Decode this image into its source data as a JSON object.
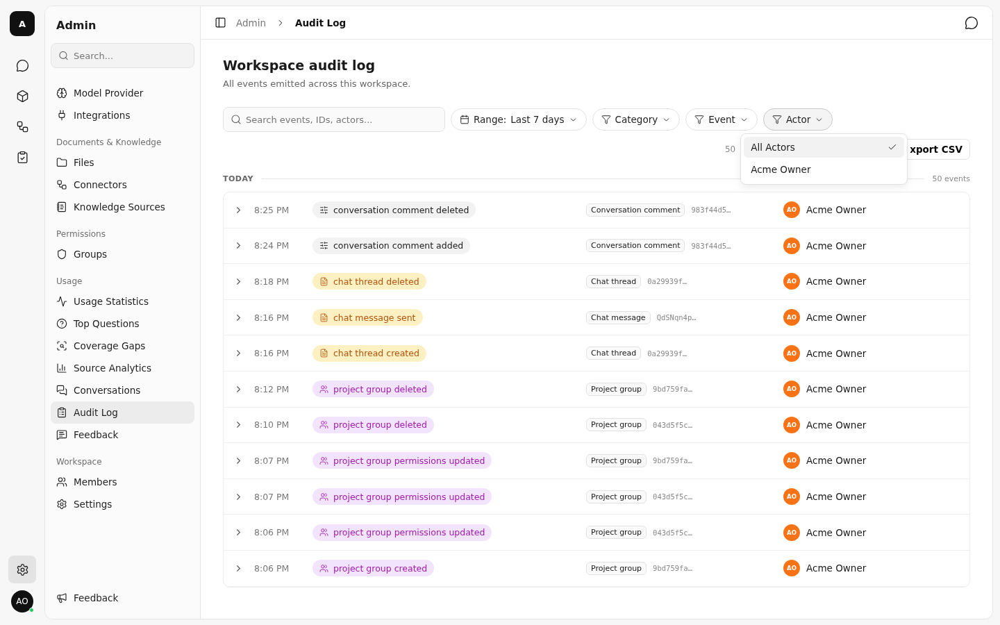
{
  "rail": {
    "logo": "A",
    "items": [
      {
        "selected": false
      },
      {
        "selected": false
      },
      {
        "selected": false
      },
      {
        "selected": false
      },
      {
        "selected": true
      }
    ],
    "avatar": {
      "initials": "AO",
      "online": true
    }
  },
  "sidebar": {
    "title": "Admin",
    "search": {
      "placeholder": "Search..."
    },
    "footer": "Feedback",
    "sections": [
      {
        "items": [
          {
            "label": "Model Provider",
            "selected": false
          },
          {
            "label": "Integrations",
            "selected": false
          }
        ]
      },
      {
        "label": "Documents & Knowledge",
        "items": [
          {
            "label": "Files",
            "selected": false
          },
          {
            "label": "Connectors",
            "selected": false
          },
          {
            "label": "Knowledge Sources",
            "selected": false
          }
        ]
      },
      {
        "label": "Permissions",
        "items": [
          {
            "label": "Groups",
            "selected": false
          }
        ]
      },
      {
        "label": "Usage",
        "items": [
          {
            "label": "Usage Statistics",
            "selected": false
          },
          {
            "label": "Top Questions",
            "selected": false
          },
          {
            "label": "Coverage Gaps",
            "selected": false
          },
          {
            "label": "Source Analytics",
            "selected": false
          },
          {
            "label": "Conversations",
            "selected": false
          },
          {
            "label": "Audit Log",
            "selected": true
          },
          {
            "label": "Feedback",
            "selected": false
          }
        ]
      },
      {
        "label": "Workspace",
        "items": [
          {
            "label": "Members",
            "selected": false
          },
          {
            "label": "Settings",
            "selected": false
          }
        ]
      }
    ]
  },
  "breadcrumb": [
    "Admin",
    "Audit Log"
  ],
  "page": {
    "title": "Workspace audit log",
    "subtitle": "All events emitted across this workspace."
  },
  "toolbar": {
    "search": {
      "placeholder": "Search events, IDs, actors..."
    },
    "range": {
      "label": "Range:",
      "value": "Last 7 days"
    },
    "filters": [
      {
        "label": "Category",
        "expanded": false
      },
      {
        "label": "Event",
        "expanded": false
      },
      {
        "label": "Actor",
        "expanded": true
      }
    ],
    "count": "50",
    "export": "xport CSV"
  },
  "actor_menu": [
    {
      "label": "All Actors",
      "selected": true
    },
    {
      "label": "Acme Owner",
      "selected": false
    }
  ],
  "group": {
    "label": "TODAY",
    "count": "50 events"
  },
  "rows": [
    {
      "time": "8:25 PM",
      "kind": "comment",
      "event": "conversation comment deleted",
      "resource": "Conversation comment",
      "id": "983f44d5…",
      "avatar": "AO",
      "actor": "Acme Owner"
    },
    {
      "time": "8:24 PM",
      "kind": "comment",
      "event": "conversation comment added",
      "resource": "Conversation comment",
      "id": "983f44d5…",
      "avatar": "AO",
      "actor": "Acme Owner"
    },
    {
      "time": "8:18 PM",
      "kind": "chat",
      "event": "chat thread deleted",
      "resource": "Chat thread",
      "id": "0a29939f…",
      "avatar": "AO",
      "actor": "Acme Owner"
    },
    {
      "time": "8:16 PM",
      "kind": "chat",
      "event": "chat message sent",
      "resource": "Chat message",
      "id": "QdSNqn4p…",
      "avatar": "AO",
      "actor": "Acme Owner"
    },
    {
      "time": "8:16 PM",
      "kind": "chat",
      "event": "chat thread created",
      "resource": "Chat thread",
      "id": "0a29939f…",
      "avatar": "AO",
      "actor": "Acme Owner"
    },
    {
      "time": "8:12 PM",
      "kind": "group",
      "event": "project group deleted",
      "resource": "Project group",
      "id": "9bd759fa…",
      "avatar": "AO",
      "actor": "Acme Owner"
    },
    {
      "time": "8:10 PM",
      "kind": "group",
      "event": "project group deleted",
      "resource": "Project group",
      "id": "043d5f5c…",
      "avatar": "AO",
      "actor": "Acme Owner"
    },
    {
      "time": "8:07 PM",
      "kind": "group",
      "event": "project group permissions updated",
      "resource": "Project group",
      "id": "9bd759fa…",
      "avatar": "AO",
      "actor": "Acme Owner"
    },
    {
      "time": "8:07 PM",
      "kind": "group",
      "event": "project group permissions updated",
      "resource": "Project group",
      "id": "043d5f5c…",
      "avatar": "AO",
      "actor": "Acme Owner"
    },
    {
      "time": "8:06 PM",
      "kind": "group",
      "event": "project group permissions updated",
      "resource": "Project group",
      "id": "043d5f5c…",
      "avatar": "AO",
      "actor": "Acme Owner"
    },
    {
      "time": "8:06 PM",
      "kind": "group",
      "event": "project group created",
      "resource": "Project group",
      "id": "9bd759fa…",
      "avatar": "AO",
      "actor": "Acme Owner"
    }
  ]
}
